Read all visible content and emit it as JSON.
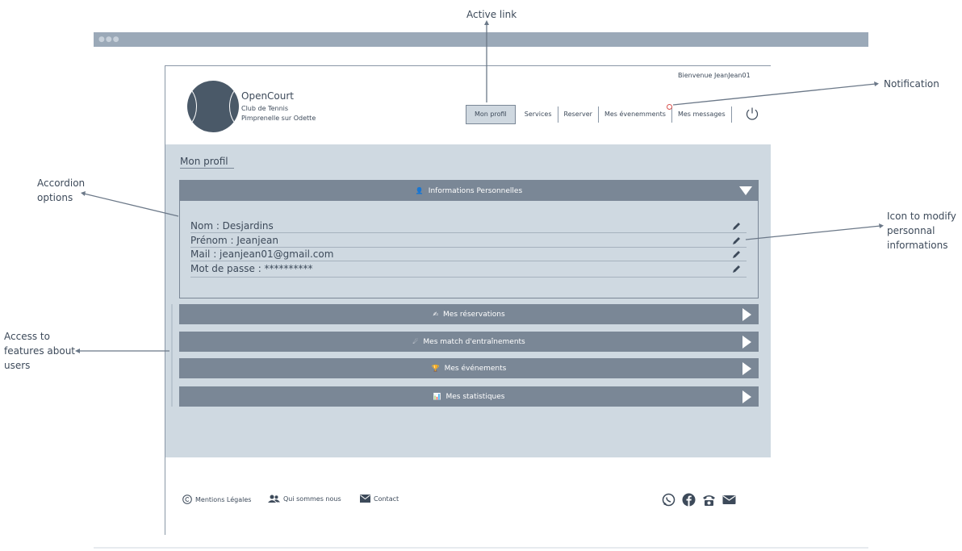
{
  "annotations": {
    "active_link": "Active link",
    "notification": "Notification",
    "accordion_options": [
      "Accordion",
      "options"
    ],
    "icon_modify": [
      "Icon to modify",
      "personnal",
      "informations"
    ],
    "access_features": [
      "Access to",
      "features about",
      "users"
    ]
  },
  "header": {
    "brand_name": "OpenCourt",
    "brand_sub1": "Club de Tennis",
    "brand_sub2": "Pimprenelle sur Odette",
    "welcome": "Bienvenue JeanJean01",
    "logo_icon": "tennis-ball-icon",
    "power_icon": "power-icon"
  },
  "nav": {
    "items": [
      "Mon profil",
      "Services",
      "Reserver",
      "Mes évenemments",
      "Mes messages"
    ],
    "active": "Mon profil"
  },
  "main": {
    "title": "Mon profil",
    "personal": {
      "label": "Informations Personnelles",
      "icon": "user-icon",
      "rows": [
        "Nom :  Desjardins",
        "Prénom : Jeanjean",
        "Mail : jeanjean01@gmail.com",
        "Mot de passe : **********"
      ]
    },
    "sections": [
      {
        "label": "Mes réservations",
        "icon": "✍"
      },
      {
        "label": "Mes match d'entraînements",
        "icon": "☄"
      },
      {
        "label": "Mes événements",
        "icon": "🏆"
      },
      {
        "label": "Mes statistiques",
        "icon": "📊"
      }
    ]
  },
  "footer": {
    "legal": "Mentions Légales",
    "about": "Qui sommes nous",
    "contact": "Contact",
    "socials": [
      "whatsapp-icon",
      "facebook-icon",
      "phone-icon",
      "mail-icon"
    ]
  },
  "colors": {
    "accordion": "#7a8796",
    "main_bg": "#cfd9e1",
    "browser_bar": "#9ba9b8",
    "notif": "#d9534f"
  }
}
